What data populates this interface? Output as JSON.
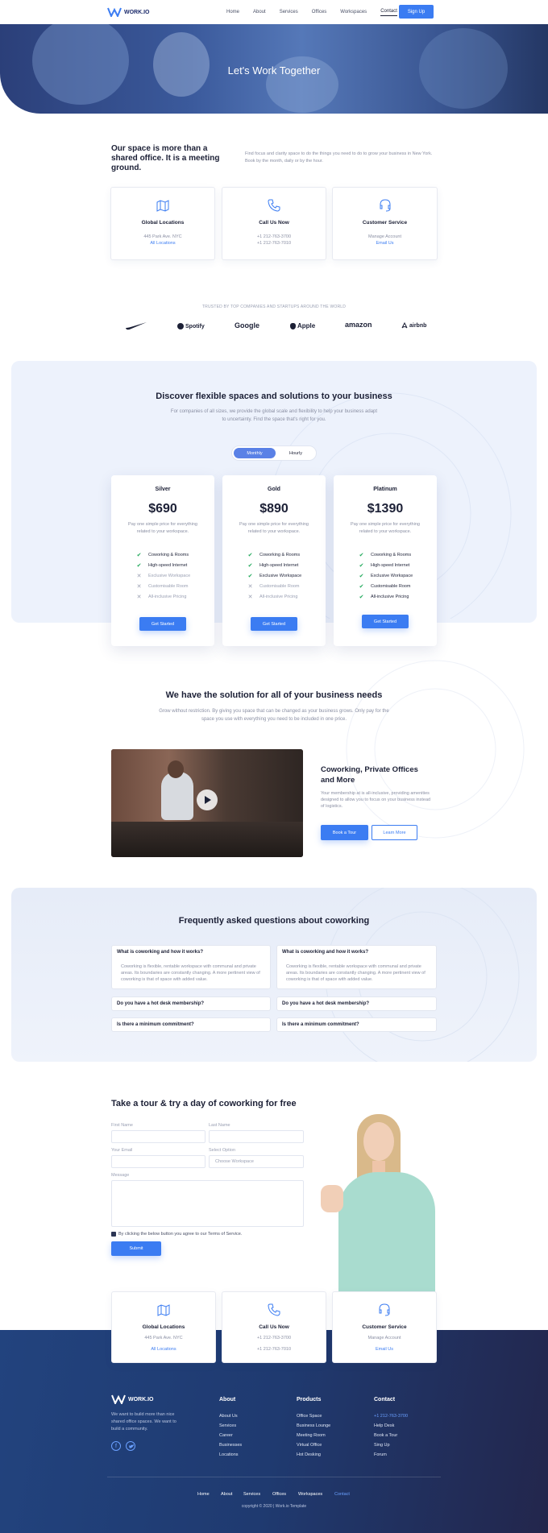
{
  "nav": {
    "brand": "WORK.IO",
    "items": [
      "Home",
      "About",
      "Services",
      "Offices",
      "Workspaces",
      "Contact"
    ],
    "active": "Contact",
    "signup": "Sign Up"
  },
  "hero": {
    "title": "Let's Work Together"
  },
  "intro": {
    "heading": "Our space is more than a shared office. It is a meeting ground.",
    "text": "Find focus and clarity space to do the things you need to do to grow your business in New York. Book by the month, daily or by the hour."
  },
  "contact_cards": [
    {
      "title": "Global Locations",
      "line1": "445 Park Ave. NYC",
      "link": "All Locations",
      "icon": "map-icon"
    },
    {
      "title": "Call Us Now",
      "line1": "+1 212-763-3700",
      "line2": "+1 212-763-7010",
      "icon": "phone-icon"
    },
    {
      "title": "Customer Service",
      "line1": "Manage Account",
      "link": "Email Us",
      "icon": "headset-icon"
    }
  ],
  "trusted": {
    "label": "TRUSTED BY TOP COMPANIES AND STARTUPS AROUND THE WORLD",
    "brands": [
      "Nike",
      "Spotify",
      "Google",
      "Apple",
      "amazon",
      "airbnb"
    ]
  },
  "pricing": {
    "heading": "Discover flexible spaces and solutions to your business",
    "sub": "For companies of all sizes, we provide the global scale and flexibility to help your business adapt to uncertainty. Find the space that's right for you.",
    "toggle": [
      "Monthly",
      "Hourly"
    ],
    "plans": [
      {
        "name": "Silver",
        "price": "$690",
        "desc": "Pay one simple price for everything related to your workspace.",
        "features": [
          [
            "Coworking & Rooms",
            true
          ],
          [
            "High-speed Internet",
            true
          ],
          [
            "Exclusive Workspace",
            false
          ],
          [
            "Customisable Room",
            false
          ],
          [
            "All-inclusive Pricing",
            false
          ]
        ],
        "cta": "Get Started"
      },
      {
        "name": "Gold",
        "price": "$890",
        "desc": "Pay one simple price for everything related to your workspace.",
        "features": [
          [
            "Coworking & Rooms",
            true
          ],
          [
            "High-speed Internet",
            true
          ],
          [
            "Exclusive Workspace",
            true
          ],
          [
            "Customisable Room",
            false
          ],
          [
            "All-inclusive Pricing",
            false
          ]
        ],
        "cta": "Get Started"
      },
      {
        "name": "Platinum",
        "price": "$1390",
        "desc": "Pay one simple price for everything related to your workspace.",
        "features": [
          [
            "Coworking & Rooms",
            true
          ],
          [
            "High-speed Internet",
            true
          ],
          [
            "Exclusive Workspace",
            true
          ],
          [
            "Customisable Room",
            true
          ],
          [
            "All-inclusive Pricing",
            true
          ]
        ],
        "cta": "Get Started"
      }
    ]
  },
  "solution": {
    "heading": "We have the solution for all of your business needs",
    "sub": "Grow without restriction. By giving you space that can be changed as your business grows. Only pay for the space you use with everything you need to be included in one price.",
    "card_title": "Coworking, Private Offices and More",
    "card_text": "Your membership at is all-inclusive, providing amenities designed to allow you to focus on your business instead of logistics.",
    "book": "Book a Tour",
    "learn": "Learn More"
  },
  "faq": {
    "heading": "Frequently asked questions about coworking",
    "items": [
      {
        "q": "What is coworking and how it works?",
        "a": "Coworking is flexible, rentable workspace with communal and private areas. Its boundaries are constantly changing. A more pertinent view of coworking is that of space with added value."
      },
      {
        "q": "What is coworking and how it works?",
        "a": "Coworking is flexible, rentable workspace with communal and private areas. Its boundaries are constantly changing. A more pertinent view of coworking is that of space with added value."
      },
      {
        "q": "Do you have a hot desk membership?"
      },
      {
        "q": "Do you have a hot desk membership?"
      },
      {
        "q": "Is there a minimum commitment?"
      },
      {
        "q": "Is there a minimum commitment?"
      }
    ]
  },
  "form": {
    "heading": "Take a tour & try a day of coworking for free",
    "first_name": "First Name",
    "last_name": "Last Name",
    "email": "Your Email",
    "select_label": "Select Option",
    "select_value": "Choose Workspace",
    "message": "Message",
    "agree": "By clicking the below button you agree to our Terms of Service.",
    "submit": "Submit"
  },
  "footer": {
    "brand": "WORK.IO",
    "tagline": "We want to build more than nice shared office spaces. We want to build a community.",
    "columns": [
      {
        "title": "About",
        "links": [
          "About Us",
          "Services",
          "Career",
          "Businesses",
          "Locations"
        ]
      },
      {
        "title": "Products",
        "links": [
          "Office Space",
          "Business Lounge",
          "Meeting Room",
          "Virtual Office",
          "Hot Desking"
        ]
      },
      {
        "title": "Contact",
        "links": [
          "+1 212-763-3700",
          "Help Desk",
          "Book a Tour",
          "Sing Up",
          "Forum"
        ]
      }
    ],
    "bottom_links": [
      "Home",
      "About",
      "Services",
      "Offices",
      "Workspaces",
      "Contact"
    ],
    "copyright": "copyright © 2020  |  Work.io Template"
  },
  "colors": {
    "accent": "#3b7cf2",
    "footer": "#22437e",
    "check": "#1fa85a"
  }
}
